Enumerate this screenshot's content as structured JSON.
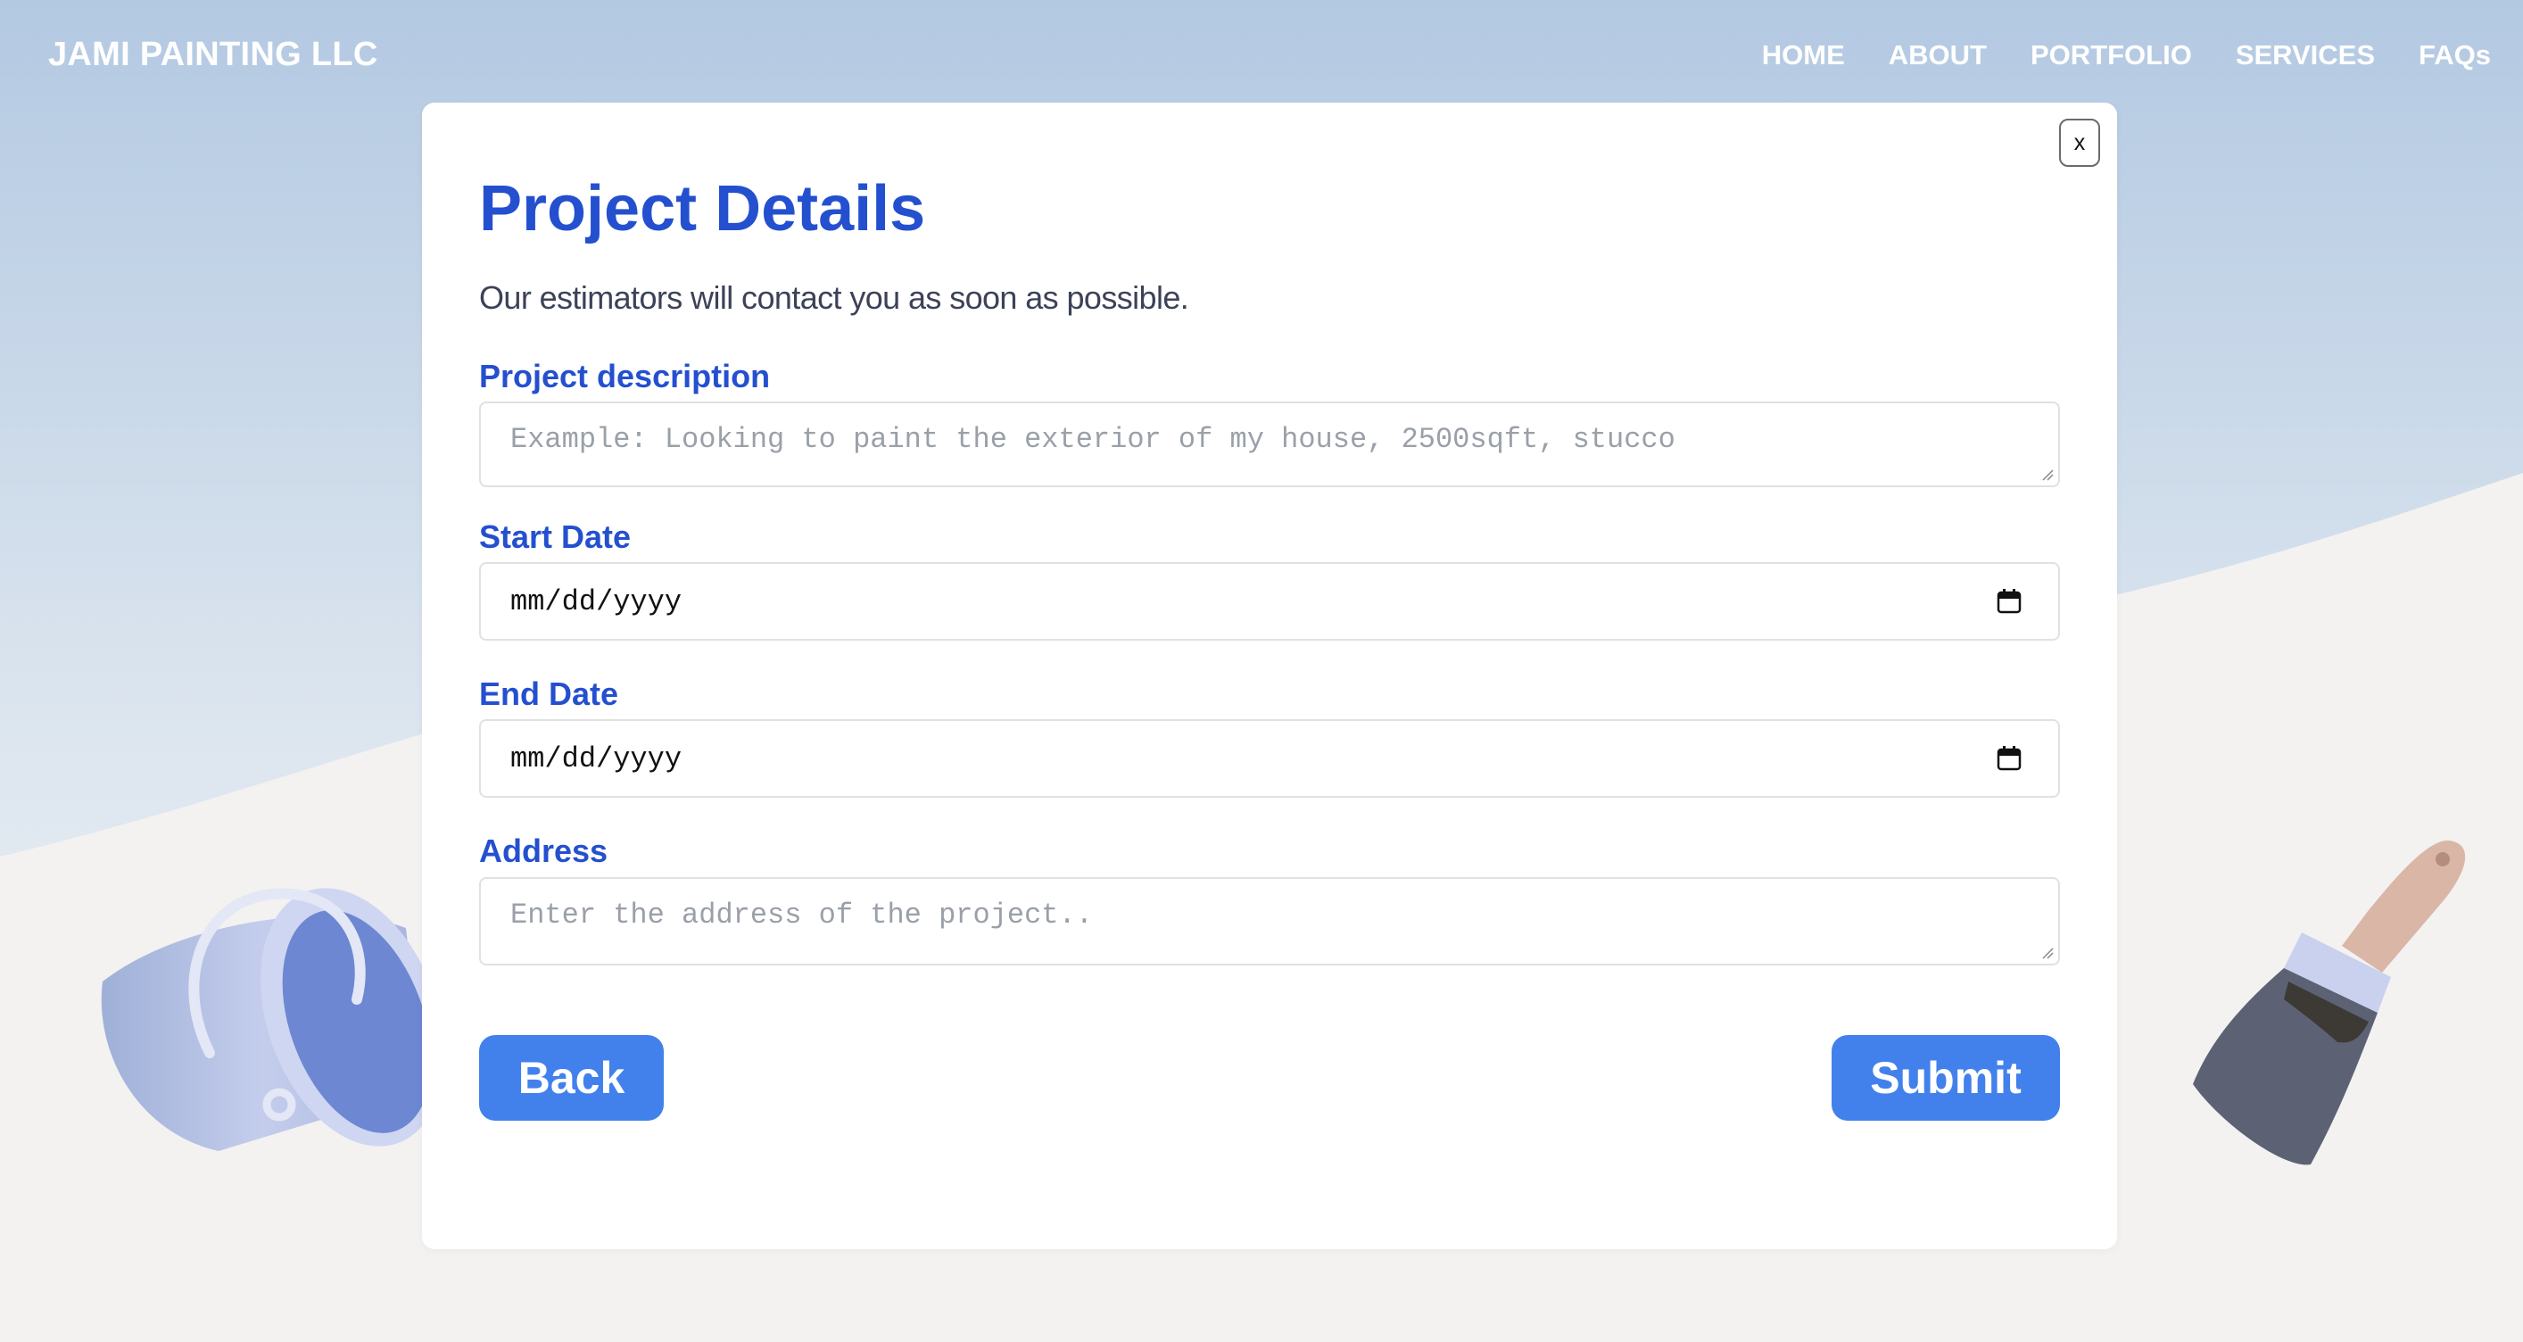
{
  "brand": "JAMI PAINTING LLC",
  "nav": [
    "HOME",
    "ABOUT",
    "PORTFOLIO",
    "SERVICES",
    "FAQs"
  ],
  "modal": {
    "close_label": "x",
    "title": "Project Details",
    "subtitle": "Our estimators will contact you as soon as possible.",
    "fields": {
      "description": {
        "label": "Project description",
        "placeholder": "Example: Looking to paint the exterior of my house, 2500sqft, stucco"
      },
      "start_date": {
        "label": "Start Date",
        "value": "mm/dd/yyyy",
        "icon": "calendar-icon"
      },
      "end_date": {
        "label": "End Date",
        "value": "mm/dd/yyyy",
        "icon": "calendar-icon"
      },
      "address": {
        "label": "Address",
        "placeholder": "Enter the address of the project.."
      }
    },
    "back_label": "Back",
    "submit_label": "Submit"
  },
  "colors": {
    "accent": "#2450cf",
    "button": "#4281ec",
    "sky_top": "#b3c9e2",
    "floor": "#f3f2f1"
  },
  "decor": [
    "paint-bucket-illustration",
    "paintbrush-illustration"
  ]
}
